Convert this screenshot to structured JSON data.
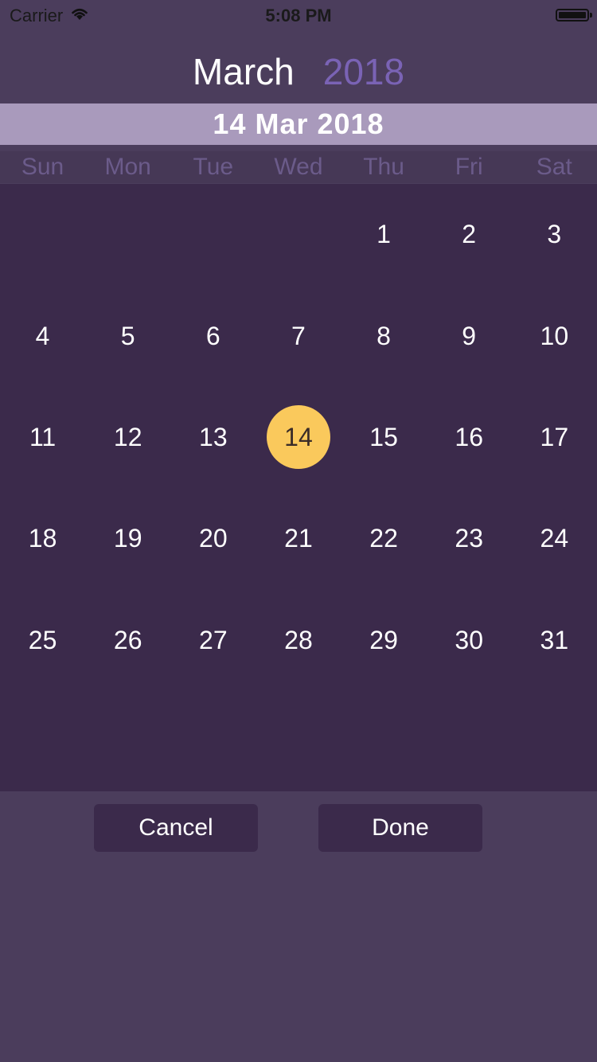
{
  "status_bar": {
    "carrier": "Carrier",
    "time": "5:08 PM",
    "icons": [
      "wifi-icon",
      "battery-icon"
    ]
  },
  "header": {
    "month": "March",
    "year": "2018"
  },
  "selected_date_label": "14 Mar 2018",
  "weekdays": [
    "Sun",
    "Mon",
    "Tue",
    "Wed",
    "Thu",
    "Fri",
    "Sat"
  ],
  "calendar": {
    "selected_day": "14",
    "weeks": [
      [
        "",
        "",
        "",
        "",
        "1",
        "2",
        "3"
      ],
      [
        "4",
        "5",
        "6",
        "7",
        "8",
        "9",
        "10"
      ],
      [
        "11",
        "12",
        "13",
        "14",
        "15",
        "16",
        "17"
      ],
      [
        "18",
        "19",
        "20",
        "21",
        "22",
        "23",
        "24"
      ],
      [
        "25",
        "26",
        "27",
        "28",
        "29",
        "30",
        "31"
      ],
      [
        "",
        "",
        "",
        "",
        "",
        "",
        ""
      ]
    ]
  },
  "buttons": {
    "cancel": "Cancel",
    "done": "Done"
  },
  "colors": {
    "background": "#4b3d5c",
    "grid_background": "#3b2a4b",
    "banner": "#a99abc",
    "year_accent": "#7a63b5",
    "weekday_text": "#6b5b8a",
    "selected_circle": "#fac95c"
  }
}
